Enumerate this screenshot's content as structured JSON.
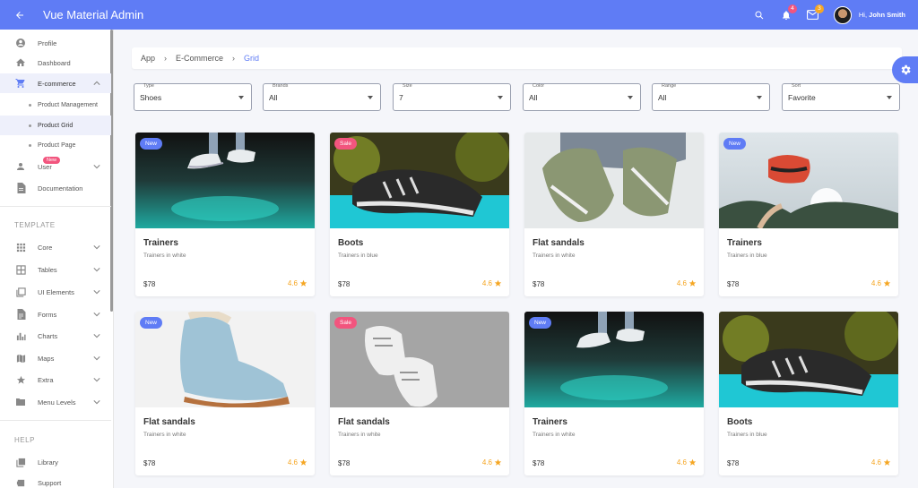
{
  "header": {
    "title": "Vue Material Admin",
    "notifications_count": "4",
    "messages_count": "3",
    "greeting": "Hi,",
    "user_name": "John Smith"
  },
  "sidebar": {
    "items": [
      {
        "label": "Profile",
        "icon": "account-circle-icon"
      },
      {
        "label": "Dashboard",
        "icon": "home-icon"
      },
      {
        "label": "E-commerce",
        "icon": "cart-icon"
      },
      {
        "label": "User",
        "icon": "person-icon",
        "badge": "New"
      },
      {
        "label": "Documentation",
        "icon": "document-icon"
      }
    ],
    "ecommerce_sub": [
      "Product Management",
      "Product Grid",
      "Product Page"
    ],
    "template_label": "TEMPLATE",
    "template_items": [
      {
        "label": "Core",
        "icon": "grid-icon"
      },
      {
        "label": "Tables",
        "icon": "table-icon"
      },
      {
        "label": "UI Elements",
        "icon": "layers-icon"
      },
      {
        "label": "Forms",
        "icon": "form-icon"
      },
      {
        "label": "Charts",
        "icon": "bar-chart-icon"
      },
      {
        "label": "Maps",
        "icon": "map-icon"
      },
      {
        "label": "Extra",
        "icon": "star-icon"
      },
      {
        "label": "Menu Levels",
        "icon": "folder-icon"
      }
    ],
    "help_label": "HELP",
    "help_items": [
      {
        "label": "Library",
        "icon": "library-icon"
      },
      {
        "label": "Support",
        "icon": "support-icon"
      }
    ]
  },
  "breadcrumb": [
    "App",
    "E-Commerce",
    "Grid"
  ],
  "filters": [
    {
      "label": "Type",
      "value": "Shoes"
    },
    {
      "label": "Brands",
      "value": "All"
    },
    {
      "label": "Size",
      "value": "7"
    },
    {
      "label": "Color",
      "value": "All"
    },
    {
      "label": "Range",
      "value": "All"
    },
    {
      "label": "Sort",
      "value": "Favorite"
    }
  ],
  "products": [
    {
      "name": "Trainers",
      "desc": "Trainers in white",
      "price": "$78",
      "rating": "4.6",
      "tag": "New"
    },
    {
      "name": "Boots",
      "desc": "Trainers in blue",
      "price": "$78",
      "rating": "4.6",
      "tag": "Sale"
    },
    {
      "name": "Flat sandals",
      "desc": "Trainers in white",
      "price": "$78",
      "rating": "4.6",
      "tag": ""
    },
    {
      "name": "Trainers",
      "desc": "Trainers in blue",
      "price": "$78",
      "rating": "4.6",
      "tag": "New"
    },
    {
      "name": "Flat sandals",
      "desc": "Trainers in white",
      "price": "$78",
      "rating": "4.6",
      "tag": "New"
    },
    {
      "name": "Flat sandals",
      "desc": "Trainers in white",
      "price": "$78",
      "rating": "4.6",
      "tag": "Sale"
    },
    {
      "name": "Trainers",
      "desc": "Trainers in white",
      "price": "$78",
      "rating": "4.6",
      "tag": "New"
    },
    {
      "name": "Boots",
      "desc": "Trainers in blue",
      "price": "$78",
      "rating": "4.6",
      "tag": ""
    }
  ],
  "colors": {
    "primary": "#5f7cf5",
    "accent_pink": "#f2557e",
    "rating": "#f5a623"
  }
}
